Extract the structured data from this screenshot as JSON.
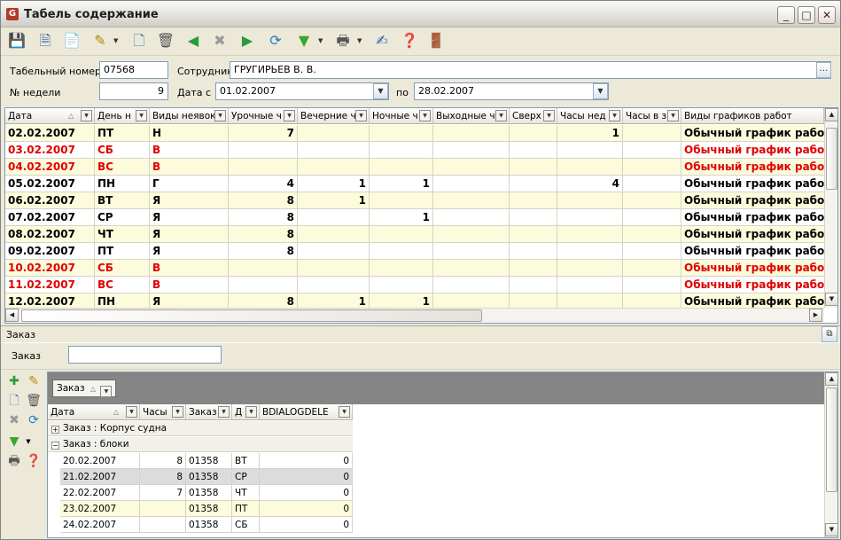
{
  "window": {
    "title": "Табель содержание"
  },
  "form": {
    "tab_num_label": "Табельный номер",
    "tab_num_value": "07568",
    "employee_label": "Сотрудник",
    "employee_value": "ГРУГИРЬЕВ В. В.",
    "week_label": "№ недели",
    "week_value": "9",
    "date_from_label": "Дата с",
    "date_from_value": "01.02.2007",
    "date_to_label": "по",
    "date_to_value": "28.02.2007"
  },
  "grid1": {
    "columns": [
      "Дата",
      "День н",
      "Виды неявок",
      "Урочные ч",
      "Вечерние ч",
      "Ночные ч",
      "Выходные ч",
      "Сверх",
      "Часы нед",
      "Часы в з",
      "Виды графиков работ"
    ],
    "rows": [
      {
        "date": "02.02.2007",
        "day": "ПТ",
        "type": "Н",
        "uroch": "7",
        "vech": "",
        "noch": "",
        "vyh": "",
        "sverh": "",
        "ned": "1",
        "vz": "",
        "graph": "Обычный график работ",
        "weekend": false
      },
      {
        "date": "03.02.2007",
        "day": "СБ",
        "type": "В",
        "uroch": "",
        "vech": "",
        "noch": "",
        "vyh": "",
        "sverh": "",
        "ned": "",
        "vz": "",
        "graph": "Обычный график работ",
        "weekend": true
      },
      {
        "date": "04.02.2007",
        "day": "ВС",
        "type": "В",
        "uroch": "",
        "vech": "",
        "noch": "",
        "vyh": "",
        "sverh": "",
        "ned": "",
        "vz": "",
        "graph": "Обычный график работ",
        "weekend": true
      },
      {
        "date": "05.02.2007",
        "day": "ПН",
        "type": "Г",
        "uroch": "4",
        "vech": "1",
        "noch": "1",
        "vyh": "",
        "sverh": "",
        "ned": "4",
        "vz": "",
        "graph": "Обычный график работ",
        "weekend": false
      },
      {
        "date": "06.02.2007",
        "day": "ВТ",
        "type": "Я",
        "uroch": "8",
        "vech": "1",
        "noch": "",
        "vyh": "",
        "sverh": "",
        "ned": "",
        "vz": "",
        "graph": "Обычный график работ",
        "weekend": false
      },
      {
        "date": "07.02.2007",
        "day": "СР",
        "type": "Я",
        "uroch": "8",
        "vech": "",
        "noch": "1",
        "vyh": "",
        "sverh": "",
        "ned": "",
        "vz": "",
        "graph": "Обычный график работ",
        "weekend": false
      },
      {
        "date": "08.02.2007",
        "day": "ЧТ",
        "type": "Я",
        "uroch": "8",
        "vech": "",
        "noch": "",
        "vyh": "",
        "sverh": "",
        "ned": "",
        "vz": "",
        "graph": "Обычный график работ",
        "weekend": false
      },
      {
        "date": "09.02.2007",
        "day": "ПТ",
        "type": "Я",
        "uroch": "8",
        "vech": "",
        "noch": "",
        "vyh": "",
        "sverh": "",
        "ned": "",
        "vz": "",
        "graph": "Обычный график работ",
        "weekend": false
      },
      {
        "date": "10.02.2007",
        "day": "СБ",
        "type": "В",
        "uroch": "",
        "vech": "",
        "noch": "",
        "vyh": "",
        "sverh": "",
        "ned": "",
        "vz": "",
        "graph": "Обычный график работ",
        "weekend": true
      },
      {
        "date": "11.02.2007",
        "day": "ВС",
        "type": "В",
        "uroch": "",
        "vech": "",
        "noch": "",
        "vyh": "",
        "sverh": "",
        "ned": "",
        "vz": "",
        "graph": "Обычный график работ",
        "weekend": true
      },
      {
        "date": "12.02.2007",
        "day": "ПН",
        "type": "Я",
        "uroch": "8",
        "vech": "1",
        "noch": "1",
        "vyh": "",
        "sverh": "",
        "ned": "",
        "vz": "",
        "graph": "Обычный график работ",
        "weekend": false
      }
    ]
  },
  "order_panel": {
    "title": "Заказ",
    "filter_label": "Заказ",
    "filter_value": ""
  },
  "grid2": {
    "group_tag": "Заказ",
    "columns": [
      "Дата",
      "Часы",
      "Заказ",
      "Д",
      "BDIALOGDELE"
    ],
    "groups": [
      {
        "label": "Заказ : Корпус судна",
        "expanded": false
      },
      {
        "label": "Заказ : блоки",
        "expanded": true
      }
    ],
    "rows": [
      {
        "date": "20.02.2007",
        "hours": "8",
        "order": "01358",
        "day": "ВТ",
        "del": "0"
      },
      {
        "date": "21.02.2007",
        "hours": "8",
        "order": "01358",
        "day": "СР",
        "del": "0"
      },
      {
        "date": "22.02.2007",
        "hours": "7",
        "order": "01358",
        "day": "ЧТ",
        "del": "0"
      },
      {
        "date": "23.02.2007",
        "hours": "",
        "order": "01358",
        "day": "ПТ",
        "del": "0"
      },
      {
        "date": "24.02.2007",
        "hours": "",
        "order": "01358",
        "day": "СБ",
        "del": "0"
      }
    ]
  },
  "icons": {
    "toolbar": [
      "save-icon",
      "document-icon",
      "document-lines-icon",
      "edit-pencil-icon",
      "new-page-icon",
      "trash-icon",
      "back-icon",
      "cancel-icon",
      "forward-icon",
      "refresh-icon",
      "filter-icon",
      "print-icon",
      "report-icon",
      "help-icon",
      "exit-door-icon"
    ]
  },
  "colors": {
    "weekend_text": "#e00000",
    "alt_row": "#fcfbdc",
    "selected_row": "#dcdcdc"
  }
}
